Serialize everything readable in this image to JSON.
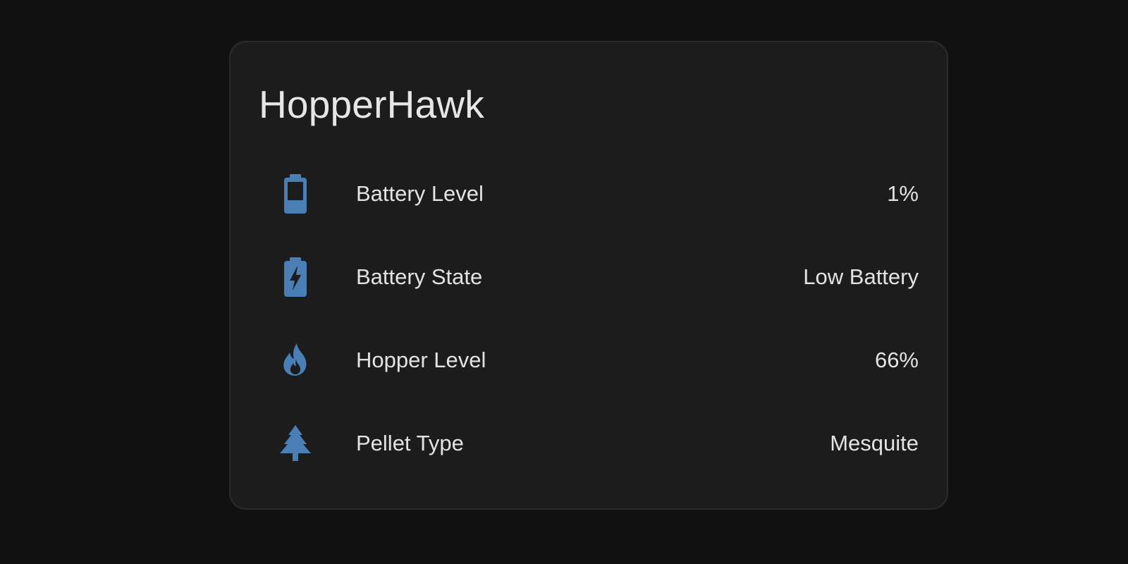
{
  "card": {
    "title": "HopperHawk"
  },
  "icon_color": "#4a7fb5",
  "rows": [
    {
      "icon": "battery-low-icon",
      "label": "Battery Level",
      "value": "1%"
    },
    {
      "icon": "battery-charging-icon",
      "label": "Battery State",
      "value": "Low Battery"
    },
    {
      "icon": "fire-icon",
      "label": "Hopper Level",
      "value": "66%"
    },
    {
      "icon": "pine-tree-icon",
      "label": "Pellet Type",
      "value": "Mesquite"
    }
  ]
}
